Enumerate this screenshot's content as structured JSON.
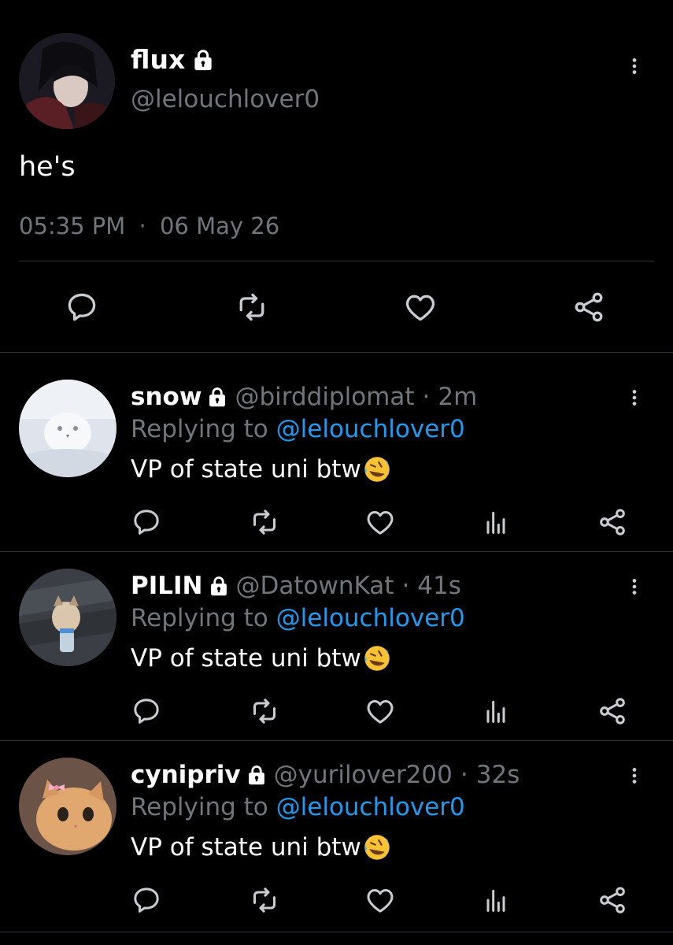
{
  "main_tweet": {
    "author_name": "flux",
    "author_handle": "@lelouchlover0",
    "text": "he's",
    "time": "05:35 PM",
    "date_separator": "·",
    "date": "06 May 26"
  },
  "replies": [
    {
      "name": "snow",
      "handle": "@birddiplomat",
      "separator": "·",
      "age": "2m",
      "replying_label": "Replying to",
      "replying_to": "@lelouchlover0",
      "text": "VP of state uni btw"
    },
    {
      "name": "PILIN",
      "handle": "@DatownKat",
      "separator": "·",
      "age": "41s",
      "replying_label": "Replying to",
      "replying_to": "@lelouchlover0",
      "text": "VP of state uni btw"
    },
    {
      "name": "cynipriv",
      "handle": "@yurilover200",
      "separator": "·",
      "age": "32s",
      "replying_label": "Replying to",
      "replying_to": "@lelouchlover0",
      "text": "VP of state uni btw"
    }
  ],
  "colors": {
    "background": "#000000",
    "primary_text": "#ffffff",
    "secondary_text": "#71767b",
    "accent": "#1d9bf0",
    "divider": "#2f3336",
    "icon": "#c9cdd1"
  },
  "icons": [
    "lock-icon",
    "more-icon",
    "reply-icon",
    "retweet-icon",
    "like-icon",
    "views-icon",
    "share-icon",
    "rofl-emoji"
  ]
}
